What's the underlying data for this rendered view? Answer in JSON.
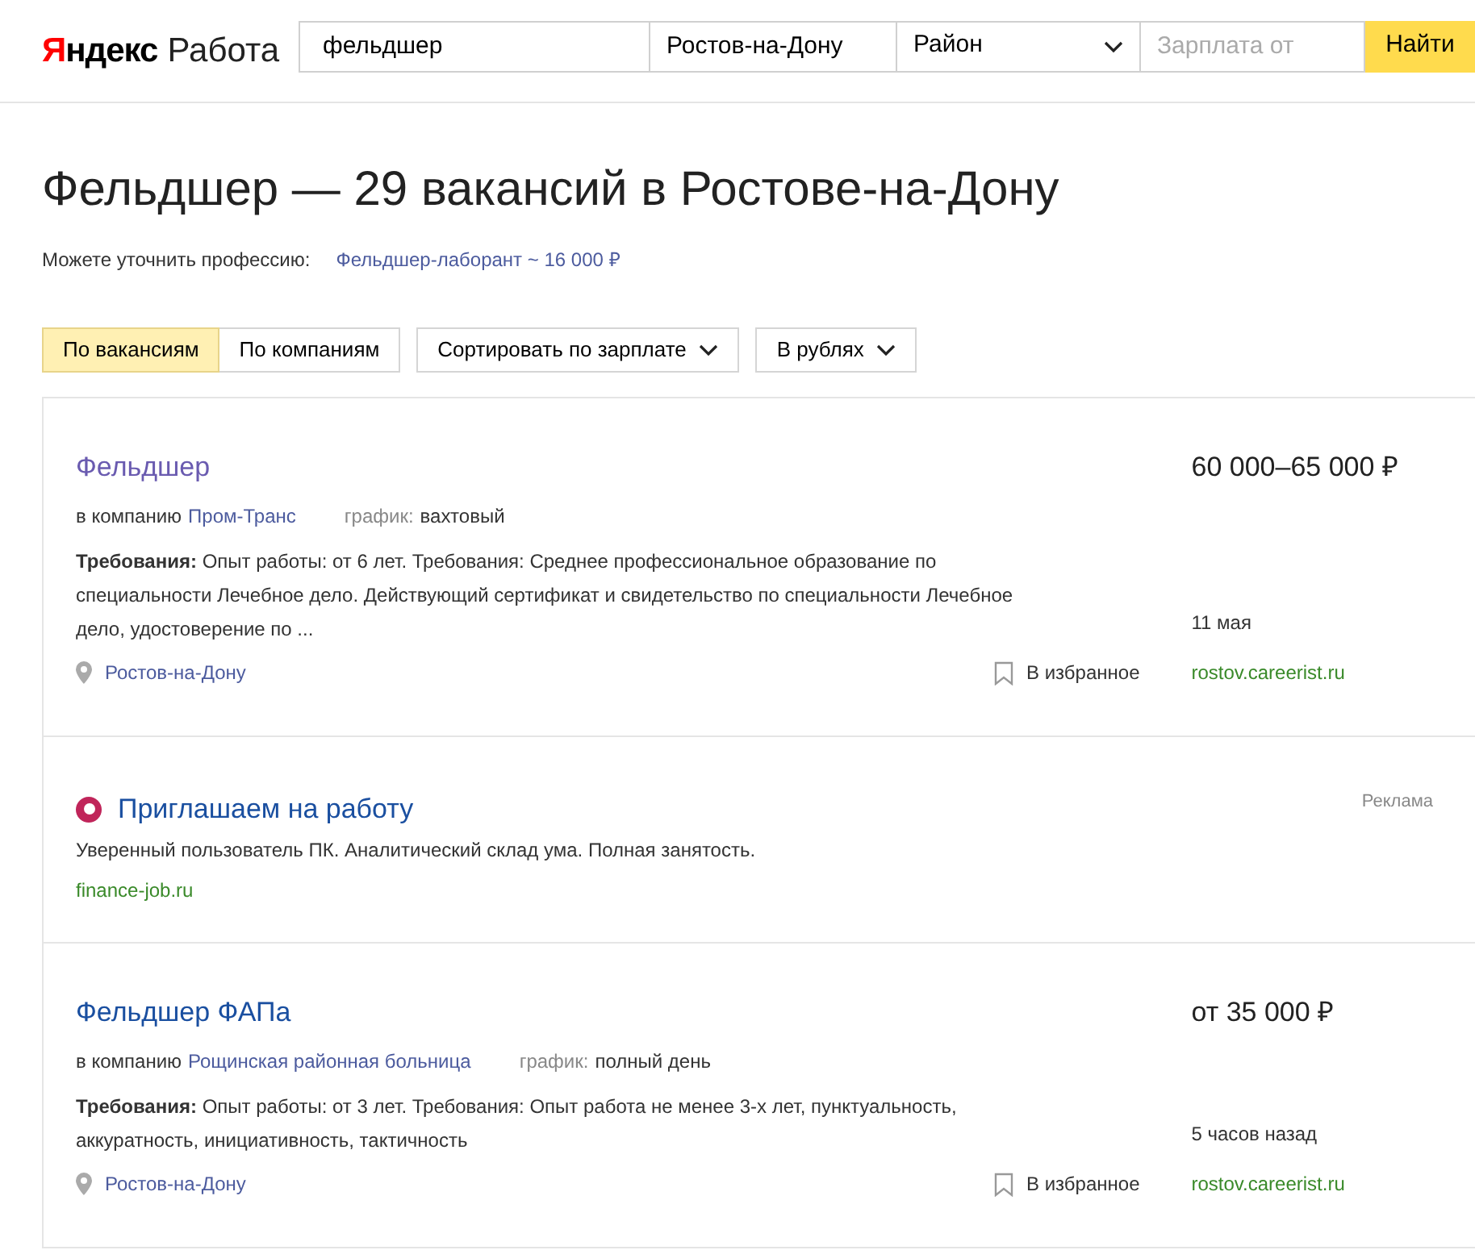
{
  "header": {
    "logo_brand": "Яндекс",
    "logo_product": "Работа",
    "search": {
      "value": "фельдшер"
    },
    "city": {
      "value": "Ростов-на-Дону"
    },
    "district": {
      "value": "Район"
    },
    "salary": {
      "placeholder": "Зарплата от"
    },
    "search_button": "Найти"
  },
  "heading": "Фельдшер — 29 вакансий в Ростове-на-Дону",
  "refine": {
    "label": "Можете уточнить профессию:",
    "suggestion": "Фельдшер-лаборант ~ 16 000 ₽"
  },
  "tabs": [
    {
      "label": "По вакансиям",
      "selected": true
    },
    {
      "label": "По компаниям",
      "selected": false
    }
  ],
  "sort_dropdowns": [
    "Сортировать по зарплате",
    "В рублях"
  ],
  "results": [
    {
      "kind": "vacancy",
      "title": "Фельдшер",
      "visited": true,
      "salary": "60 000–65 000 ₽",
      "company_label": "в компанию",
      "company": "Пром-Транс",
      "schedule_label": "график:",
      "schedule": "вахтовый",
      "requirements": "**Требования:** Опыт работы: от 6 лет. Требования: Среднее профессиональное образование по специальности Лечебное дело. Действующий сертификат и свидетельство по специальности Лечебное дело, удостоверение по ...",
      "date": "11 мая",
      "location": "Ростов-на-Дону",
      "favorite": "В избранное",
      "source": "rostov.careerist.ru"
    },
    {
      "kind": "ad",
      "title": "Приглашаем на работу",
      "badge": "Реклама",
      "text": "Уверенный пользователь ПК. Аналитический склад ума. Полная занятость.",
      "domain": "finance-job.ru"
    },
    {
      "kind": "vacancy",
      "title": "Фельдшер ФАПа",
      "visited": false,
      "salary": "от 35 000 ₽",
      "company_label": "в компанию",
      "company": "Рощинская районная больница",
      "schedule_label": "график:",
      "schedule": "полный день",
      "requirements": "**Требования:** Опыт работы: от 3 лет. Требования: Опыт работа не менее 3-х лет, пунктуальность, аккуратность, инициативность, тактичность",
      "date": "5 часов назад",
      "location": "Ростов-на-Дону",
      "favorite": "В избранное",
      "source": "rostov.careerist.ru"
    }
  ]
}
